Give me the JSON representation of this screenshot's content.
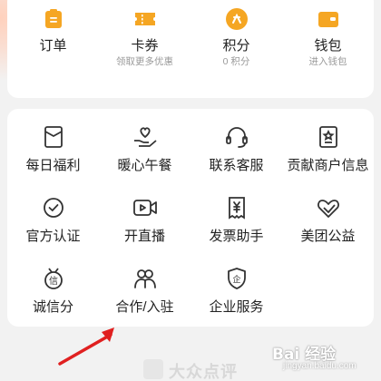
{
  "top_items": [
    {
      "label": "订单",
      "sub": "",
      "icon": "order-icon"
    },
    {
      "label": "卡券",
      "sub": "领取更多优惠",
      "icon": "coupon-icon"
    },
    {
      "label": "积分",
      "sub": "0 积分",
      "icon": "points-icon"
    },
    {
      "label": "钱包",
      "sub": "进入钱包",
      "icon": "wallet-icon"
    }
  ],
  "services": [
    {
      "label": "每日福利",
      "icon": "red-packet-icon"
    },
    {
      "label": "暖心午餐",
      "icon": "heart-hand-icon"
    },
    {
      "label": "联系客服",
      "icon": "headset-icon"
    },
    {
      "label": "贡献商户信息",
      "icon": "merchant-card-icon"
    },
    {
      "label": "官方认证",
      "icon": "check-circle-icon"
    },
    {
      "label": "开直播",
      "icon": "live-camera-icon"
    },
    {
      "label": "发票助手",
      "icon": "invoice-icon"
    },
    {
      "label": "美团公益",
      "icon": "charity-heart-icon"
    },
    {
      "label": "诚信分",
      "icon": "credit-medal-icon"
    },
    {
      "label": "合作/入驻",
      "icon": "cooperation-icon"
    },
    {
      "label": "企业服务",
      "icon": "enterprise-shield-icon"
    }
  ],
  "watermark": {
    "text": "大众点评"
  },
  "baidu_watermark": {
    "text": "Bai 经验",
    "url": "jingyan.baidu.com"
  },
  "colors": {
    "accent": "#f5a623",
    "arrow": "#e02020",
    "text": "#222222",
    "subtext": "#9a9a9a"
  }
}
